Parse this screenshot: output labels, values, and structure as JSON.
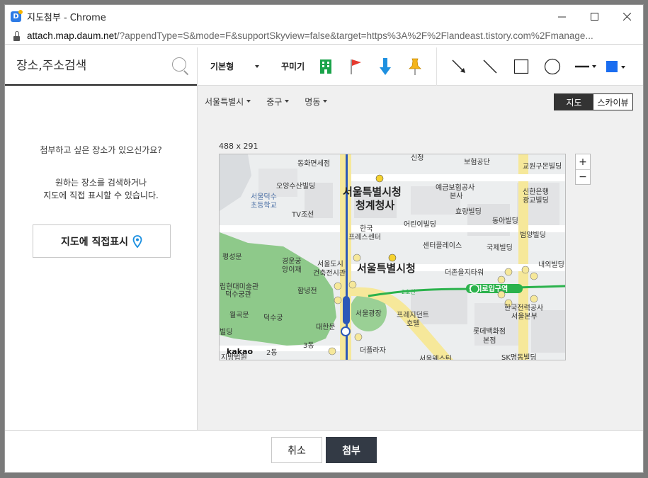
{
  "window": {
    "title": "지도첨부 - Chrome",
    "url_host": "attach.map.daum.net",
    "url_rest": "/?appendType=S&mode=F&supportSkyview=false&target=https%3A%2F%2Flandeast.tistory.com%2Fmanage..."
  },
  "search": {
    "placeholder": "장소,주소검색"
  },
  "help": {
    "question": "첨부하고 싶은 장소가 있으신가요?",
    "line1": "원하는 장소를 검색하거나",
    "line2": "지도에 직접 표시할 수 있습니다.",
    "direct_button": "지도에 직접표시"
  },
  "toolbar": {
    "style_select": "기본형",
    "decorate_label": "꾸미기",
    "icons": [
      "building-icon",
      "flag-icon",
      "arrow-down-icon",
      "pin-marker-icon"
    ],
    "draw_tools": [
      "arrow-line-icon",
      "line-icon",
      "rectangle-icon",
      "circle-icon",
      "line-style-icon",
      "color-picker-icon"
    ],
    "accent_color": "#1a6df0"
  },
  "location": {
    "city": "서울특별시",
    "district": "중구",
    "dong": "명동"
  },
  "view_toggle": {
    "map": "지도",
    "skyview": "스카이뷰"
  },
  "map": {
    "size_label": "488 x 291",
    "labels": {
      "city_hall_annex_1": "서울특별시청",
      "city_hall_annex_2": "청계청사",
      "city_hall": "서울특별시청",
      "donghwa": "동화면세점",
      "boheom": "보험공단",
      "gyowon": "교원구몬빌딩",
      "oyang": "오양수산빌딩",
      "yegeum": "예금보험공사",
      "bonsa": "본사",
      "shinhan": "신한은행",
      "gwanggyo": "광교빌딩",
      "deoksu_school_1": "서울덕수",
      "deoksu_school_2": "초등학교",
      "tv": "TV조선",
      "hyoryang": "효량빌딩",
      "donga": "동아빌딩",
      "hankook_1": "한국",
      "hankook_2": "프레스센터",
      "eorini": "어린이빌딩",
      "beomyang": "범양빌딩",
      "center_place": "센터플레이스",
      "gukje": "국제빌딩",
      "pyeongsungmun": "평성문",
      "gyeongungung_1": "경운궁",
      "gyeongungung_2": "앙이재",
      "library_1": "서울도시",
      "library_2": "건축전시관",
      "deoreom": "더존을지타워",
      "naeoe": "내외빌딩",
      "museum_1": "립현대미술관",
      "museum_2": "덕수궁관",
      "hamnyeong": "함녕전",
      "eulji_station": "을지로입구역",
      "line2": "2호선",
      "wolgongmun": "월곡문",
      "deoksugung": "덕수궁",
      "plaza": "서울광장",
      "president_1": "프레지던트",
      "president_2": "호텔",
      "korea_power_1": "한국전력공사",
      "korea_power_2": "서울본부",
      "daehanmun": "대한문",
      "lotte_1": "롯데백화점",
      "lotte_2": "본점",
      "bilding": "빌딩",
      "plaza_hotel": "더플라자",
      "sk": "SK명동빌딩",
      "seoul_westin": "서울웨스틴",
      "jibeopwon": "지방법원",
      "three_dong": "3동",
      "two_dong": "2동",
      "kakao": "kakao",
      "sinseung": "신정"
    }
  },
  "footer": {
    "cancel": "취소",
    "attach": "첨부"
  }
}
